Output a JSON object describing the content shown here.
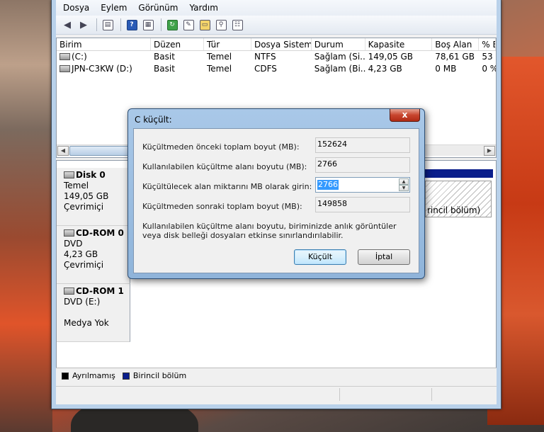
{
  "menu": [
    "Dosya",
    "Eylem",
    "Görünüm",
    "Yardım"
  ],
  "toolbar_icons": [
    "back-arrow-icon",
    "forward-arrow-icon",
    "pane-icon",
    "help-icon",
    "properties-pane-icon",
    "refresh-icon",
    "settings-icon",
    "open-folder-icon",
    "search-icon",
    "properties-icon"
  ],
  "volume_list": {
    "headers": [
      "Birim",
      "Düzen",
      "Tür",
      "Dosya Sistemi",
      "Durum",
      "Kapasite",
      "Boş Alan",
      "% B"
    ],
    "rows": [
      [
        "(C:)",
        "Basit",
        "Temel",
        "NTFS",
        "Sağlam (Si...",
        "149,05 GB",
        "78,61 GB",
        "53"
      ],
      [
        "JPN-C3KW (D:)",
        "Basit",
        "Temel",
        "CDFS",
        "Sağlam (Bi...",
        "4,23 GB",
        "0 MB",
        "0 %"
      ]
    ]
  },
  "disks": [
    {
      "name": "Disk 0",
      "type": "Temel",
      "size": "149,05 GB",
      "status": "Çevrimiçi"
    },
    {
      "name": "CD-ROM 0",
      "type": "DVD",
      "size": "4,23 GB",
      "status": "Çevrimiçi"
    },
    {
      "name": "CD-ROM 1",
      "type": "DVD (E:)",
      "size": "",
      "status": "Medya Yok"
    }
  ],
  "partition_label": "rincil bölüm)",
  "legend": {
    "unallocated": "Ayrılmamış",
    "primary": "Birincil bölüm"
  },
  "dialog": {
    "title": "C küçült:",
    "close": "x",
    "rows": [
      {
        "label": "Küçültmeden önceki toplam boyut (MB):",
        "value": "152624"
      },
      {
        "label": "Kullanılabilen küçültme alanı boyutu (MB):",
        "value": "2766"
      },
      {
        "label": "Küçültülecek alan miktarını MB olarak girin:",
        "value": "2766"
      },
      {
        "label": "Küçültmeden sonraki toplam boyut (MB):",
        "value": "149858"
      }
    ],
    "note": "Kullanılabilen küçültme alanı boyutu, biriminizde anlık görüntüler veya disk belleği dosyaları etkinse sınırlandırılabilir.",
    "ok_label": "Küçült",
    "cancel_label": "İptal"
  },
  "colors": {
    "primary_partition": "#0a1e8c",
    "close_button": "#c8452e",
    "selection": "#3399ff"
  }
}
